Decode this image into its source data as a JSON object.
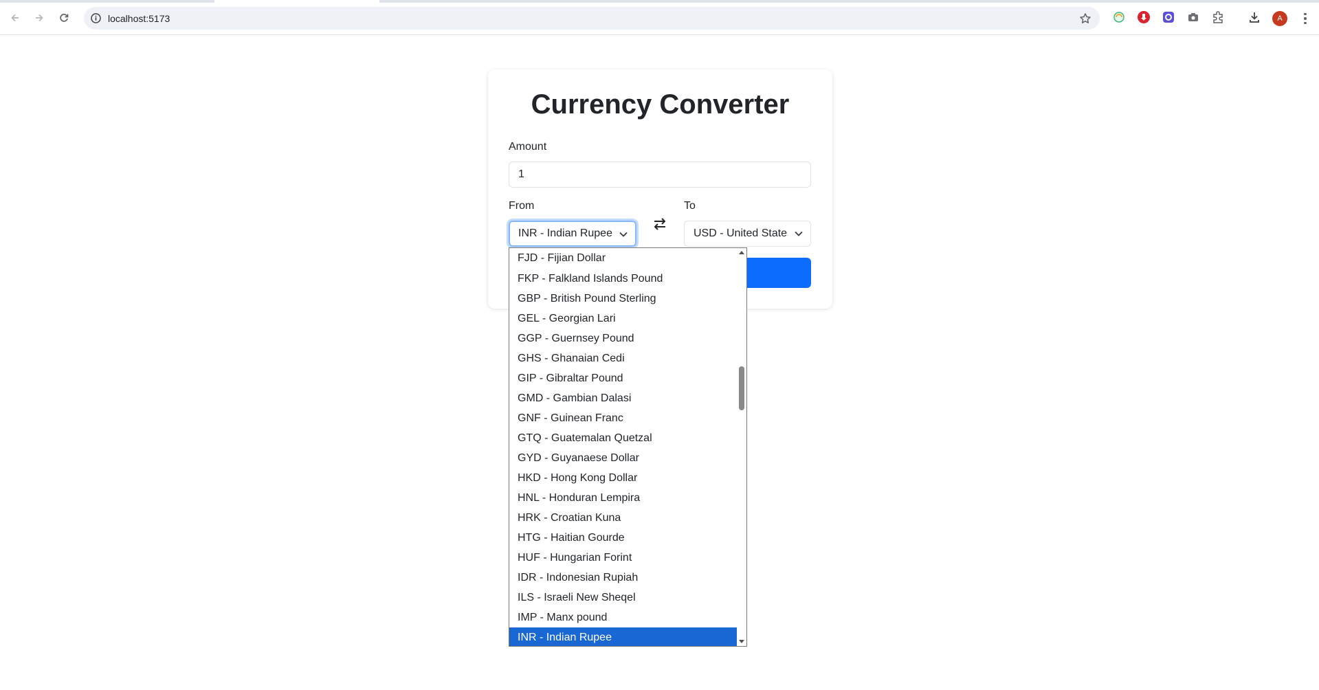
{
  "browser": {
    "url": "localhost:5173",
    "avatar_letter": "A"
  },
  "app": {
    "title": "Currency Converter",
    "amount_label": "Amount",
    "amount_value": "1",
    "from_label": "From",
    "from_value": "INR - Indian Rupee",
    "to_label": "To",
    "to_value": "USD - United States Dollar"
  },
  "dropdown": {
    "options": [
      "FJD - Fijian Dollar",
      "FKP - Falkland Islands Pound",
      "GBP - British Pound Sterling",
      "GEL - Georgian Lari",
      "GGP - Guernsey Pound",
      "GHS - Ghanaian Cedi",
      "GIP - Gibraltar Pound",
      "GMD - Gambian Dalasi",
      "GNF - Guinean Franc",
      "GTQ - Guatemalan Quetzal",
      "GYD - Guyanaese Dollar",
      "HKD - Hong Kong Dollar",
      "HNL - Honduran Lempira",
      "HRK - Croatian Kuna",
      "HTG - Haitian Gourde",
      "HUF - Hungarian Forint",
      "IDR - Indonesian Rupiah",
      "ILS - Israeli New Sheqel",
      "IMP - Manx pound",
      "INR - Indian Rupee"
    ],
    "selected": "INR - Indian Rupee"
  },
  "colors": {
    "primary": "#0d6efd",
    "selected_option": "#1967d2",
    "text": "#212529"
  }
}
